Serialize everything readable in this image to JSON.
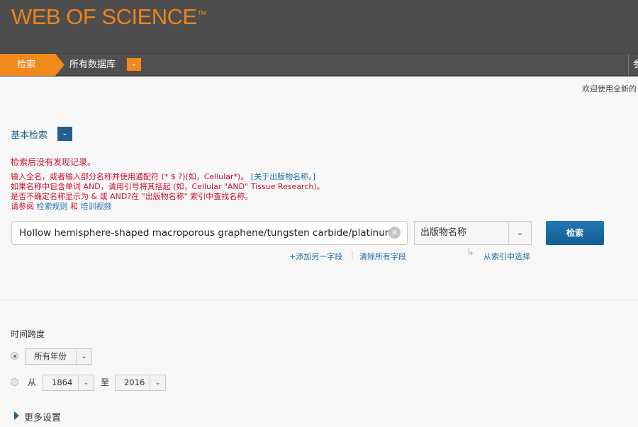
{
  "header": {
    "logo": "WEB OF SCIENCE",
    "tm": "™"
  },
  "nav": {
    "search_tab": "检索",
    "database": "所有数据库",
    "right_cut": "参"
  },
  "welcome": "欢迎使用全新的",
  "basic_search": "基本检索",
  "messages": {
    "no_records": "检索后没有发现记录。",
    "line1": "输入全名，或者输入部分名称并使用通配符 (* $ ?)(如，Cellular*)。",
    "line1_link": "[关于出版物名称。]",
    "line2": "如果名称中包含单词 AND，请用引号将其括起 (如，Cellular \"AND\" Tissue Research)。",
    "line3": "是否不确定名称显示为 & 或 AND?在 \"出版物名称\" 索引中查找名称。",
    "see": "请参阅",
    "rules_link": "检索规则",
    "and": "和",
    "video_link": "培训视频"
  },
  "search": {
    "value": "Hollow hemisphere-shaped macroporous graphene/tungsten carbide/platinum",
    "field": "出版物名称",
    "button": "检索",
    "add_field": "+添加另一字段",
    "clear_all": "清除所有字段",
    "from_index": "从索引中选择"
  },
  "timespan": {
    "label": "时间跨度",
    "all_years": "所有年份",
    "from": "从",
    "from_year": "1864",
    "to": "至",
    "to_year": "2016",
    "selected": "all_years"
  },
  "more_settings": "更多设置"
}
